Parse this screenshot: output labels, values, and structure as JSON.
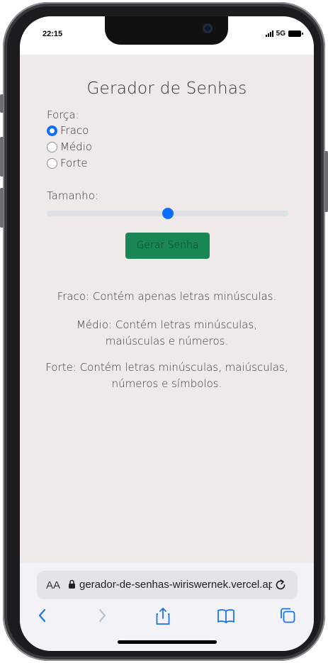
{
  "status_bar": {
    "time": "22:15",
    "network": "5G"
  },
  "page": {
    "title": "Gerador de Senhas",
    "strength_label": "Força:",
    "options": [
      {
        "label": "Fraco",
        "selected": true
      },
      {
        "label": "Médio",
        "selected": false
      },
      {
        "label": "Forte",
        "selected": false
      }
    ],
    "size_label": "Tamanho:",
    "slider_value_fraction": 0.5,
    "generate_button": "Gerar Senha",
    "descriptions": [
      "Fraco: Contém apenas letras minúsculas.",
      "Médio: Contém letras minúsculas,\nmaiúsculas e números.",
      "Forte: Contém letras minúsculas, maiúsculas,\nnúmeros e símbolos."
    ]
  },
  "browser": {
    "aa_label": "AA",
    "url": "gerador-de-senhas-wiriswernek.vercel.app",
    "icons": [
      "lock-icon",
      "reload-icon",
      "back-icon",
      "forward-icon",
      "share-icon",
      "bookmarks-icon",
      "tabs-icon"
    ]
  },
  "colors": {
    "accent": "#0d6efd",
    "button": "#198754",
    "page_bg": "#efe9e9"
  }
}
